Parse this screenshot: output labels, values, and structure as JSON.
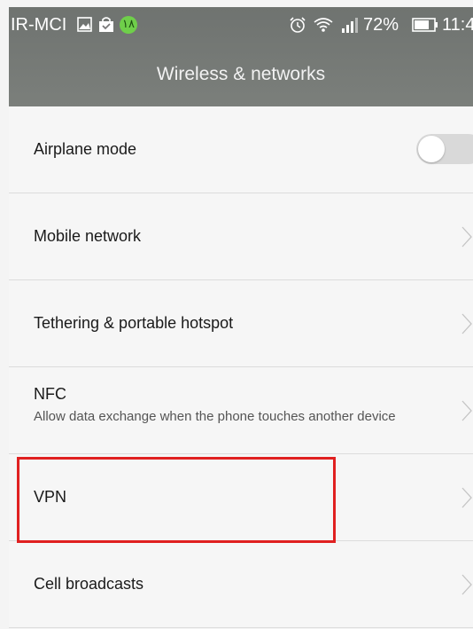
{
  "status_bar": {
    "carrier": "IR-MCI",
    "badge_number": "۱۸",
    "battery": "72%",
    "time": "11:4"
  },
  "header": {
    "title": "Wireless & networks"
  },
  "rows": [
    {
      "label": "Airplane mode",
      "toggle": "off"
    },
    {
      "label": "Mobile network"
    },
    {
      "label": "Tethering & portable hotspot"
    },
    {
      "label": "NFC",
      "sublabel": "Allow data exchange when the phone touches another device"
    },
    {
      "label": "VPN"
    },
    {
      "label": "Cell broadcasts"
    }
  ],
  "colors": {
    "highlight": "#e02020",
    "header": "#767a77"
  }
}
